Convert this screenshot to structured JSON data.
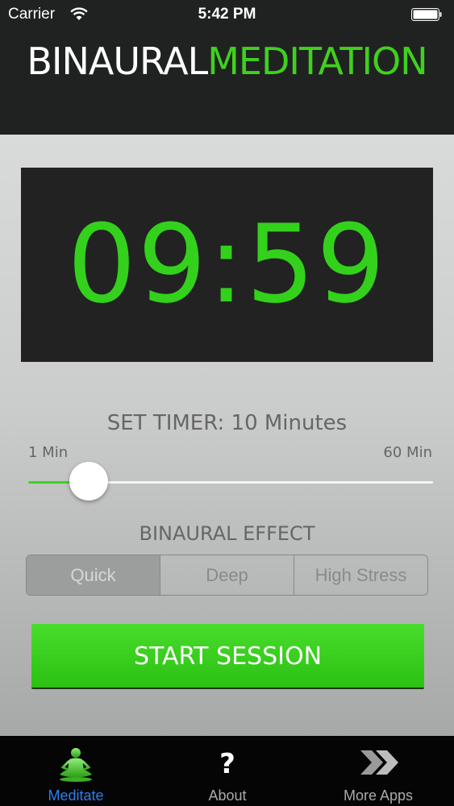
{
  "status_bar": {
    "carrier": "Carrier",
    "time": "5:42 PM"
  },
  "header": {
    "title_part1": "BINAURAL",
    "title_part2": "MEDITATION"
  },
  "timer": {
    "display": "09:59"
  },
  "set_timer": {
    "label": "SET TIMER:  10 Minutes",
    "min_label": "1 Min",
    "max_label": "60 Min",
    "value_fraction": 0.15
  },
  "binaural_effect": {
    "title": "BINAURAL EFFECT",
    "options": [
      "Quick",
      "Deep",
      "High Stress"
    ],
    "selected": "Quick"
  },
  "start_button": {
    "label": "START SESSION"
  },
  "tabs": [
    {
      "label": "Meditate",
      "icon": "meditate-icon",
      "active": true
    },
    {
      "label": "About",
      "icon": "question-icon",
      "active": false
    },
    {
      "label": "More Apps",
      "icon": "double-chevron-icon",
      "active": false
    }
  ],
  "colors": {
    "accent_green": "#3fd11d",
    "tab_active": "#2b7ef0",
    "header_bg": "#202221"
  }
}
